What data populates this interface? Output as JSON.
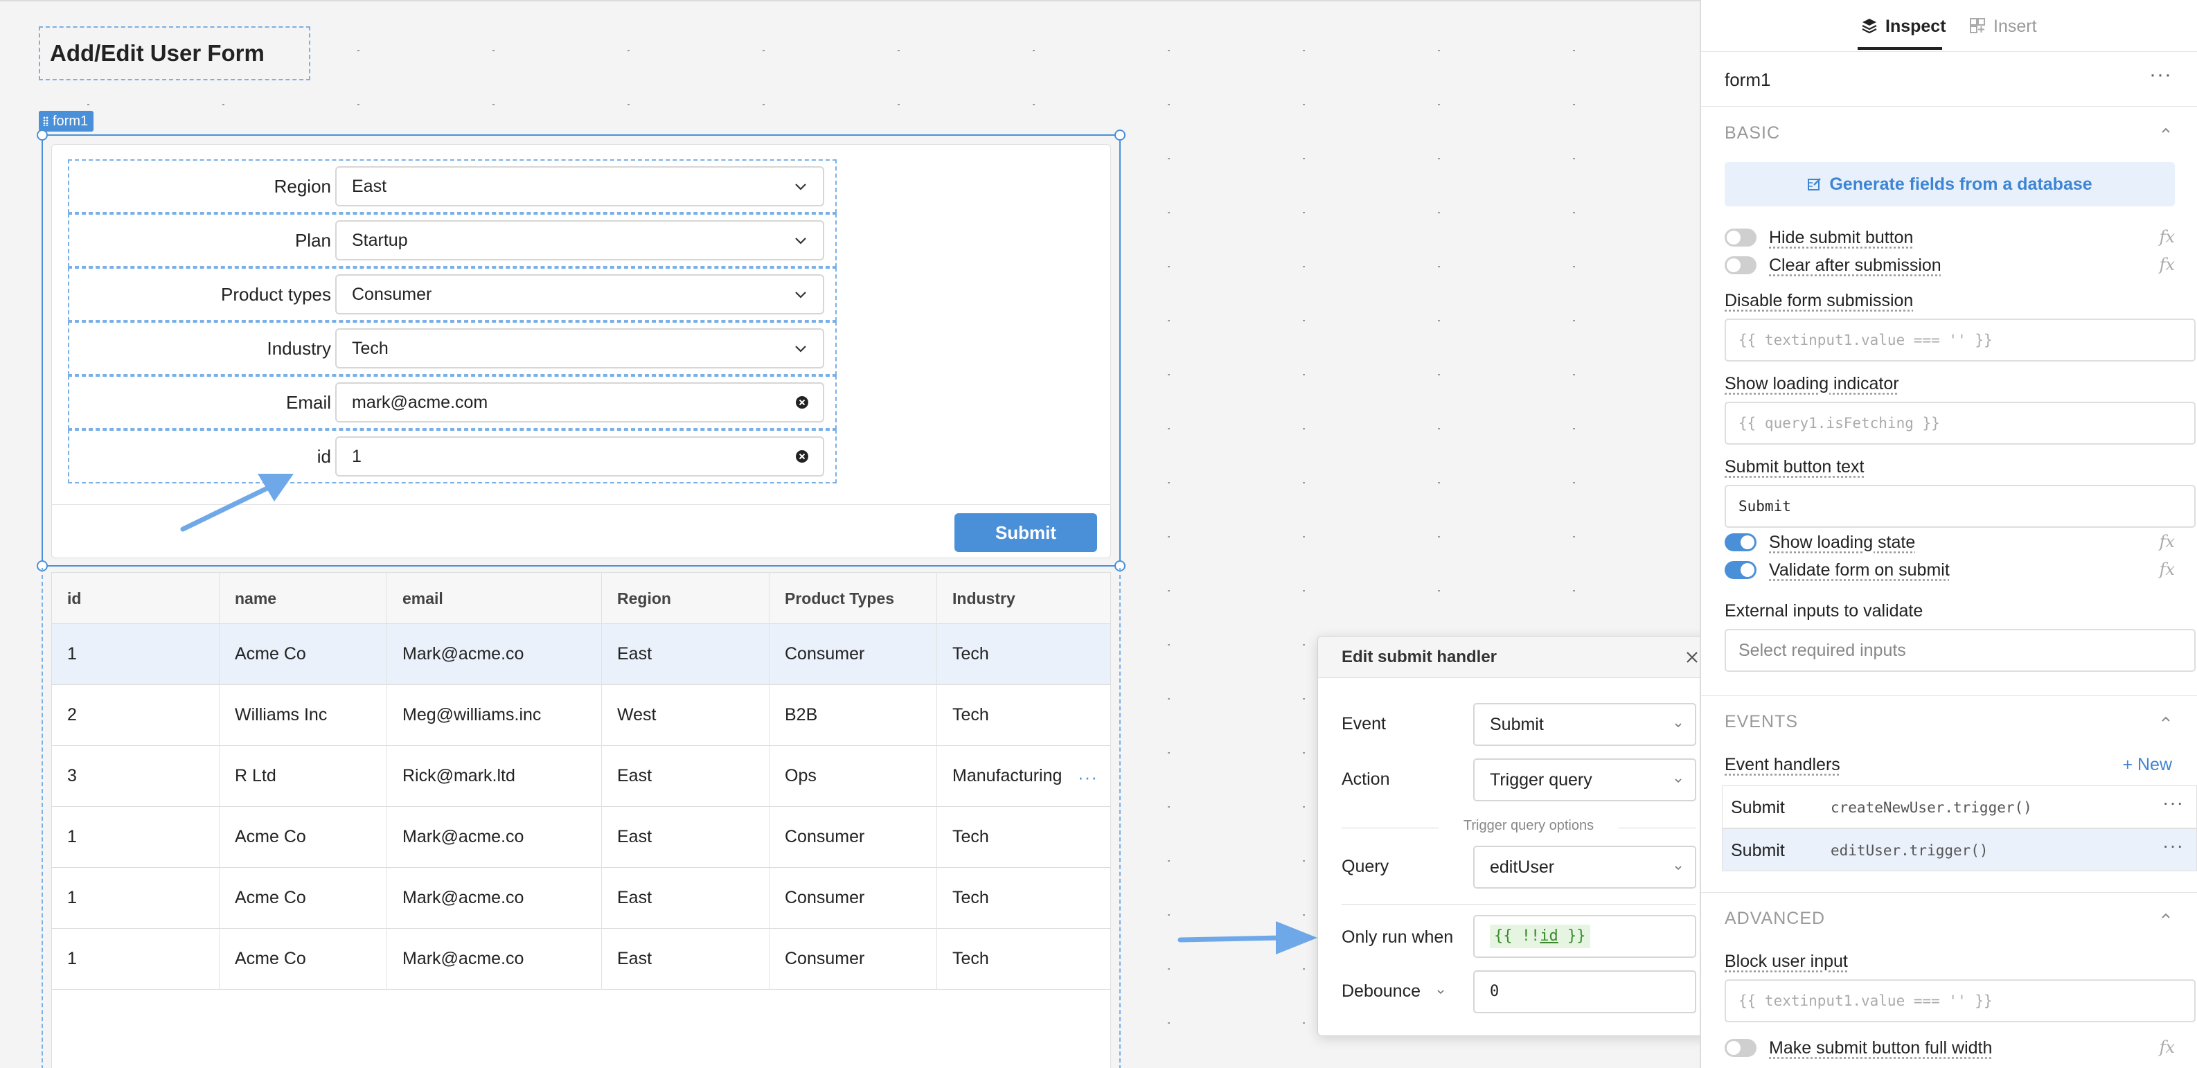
{
  "app": {
    "page_title": "Add/Edit User Form",
    "form_tag": "form1"
  },
  "form": {
    "fields": [
      {
        "label": "Region",
        "value": "East",
        "type": "select"
      },
      {
        "label": "Plan",
        "value": "Startup",
        "type": "select"
      },
      {
        "label": "Product types",
        "value": "Consumer",
        "type": "select"
      },
      {
        "label": "Industry",
        "value": "Tech",
        "type": "select"
      },
      {
        "label": "Email",
        "value": "mark@acme.com",
        "type": "text"
      },
      {
        "label": "id",
        "value": "1",
        "type": "text"
      }
    ],
    "submit_label": "Submit"
  },
  "table": {
    "columns": [
      "id",
      "name",
      "email",
      "Region",
      "Product Types",
      "Industry"
    ],
    "rows": [
      [
        "1",
        "Acme Co",
        "Mark@acme.co",
        "East",
        "Consumer",
        "Tech"
      ],
      [
        "2",
        "Williams Inc",
        "Meg@williams.inc",
        "West",
        "B2B",
        "Tech"
      ],
      [
        "3",
        "R Ltd",
        "Rick@mark.ltd",
        "East",
        "Ops",
        "Manufacturing"
      ],
      [
        "1",
        "Acme Co",
        "Mark@acme.co",
        "East",
        "Consumer",
        "Tech"
      ],
      [
        "1",
        "Acme Co",
        "Mark@acme.co",
        "East",
        "Consumer",
        "Tech"
      ],
      [
        "1",
        "Acme Co",
        "Mark@acme.co",
        "East",
        "Consumer",
        "Tech"
      ]
    ],
    "row_more": "···"
  },
  "popover": {
    "title": "Edit submit handler",
    "event_label": "Event",
    "event_value": "Submit",
    "action_label": "Action",
    "action_value": "Trigger query",
    "section_label": "Trigger query options",
    "query_label": "Query",
    "query_value": "editUser",
    "only_run_label": "Only run when",
    "only_run_open": "{{ ",
    "only_run_bang": "!!",
    "only_run_var": "id",
    "only_run_close": " }}",
    "debounce_label": "Debounce",
    "debounce_value": "0"
  },
  "inspector": {
    "tabs": {
      "inspect": "Inspect",
      "insert": "Insert"
    },
    "component_name": "form1",
    "more": "···",
    "basic": {
      "title": "BASIC",
      "generate_button": "Generate fields from a database",
      "hide_submit": "Hide submit button",
      "clear_after": "Clear after submission",
      "disable_label": "Disable form submission",
      "disable_placeholder": "{{ textinput1.value === '' }}",
      "loading_label": "Show loading indicator",
      "loading_placeholder": "{{ query1.isFetching }}",
      "submit_text_label": "Submit button text",
      "submit_text_value": "Submit",
      "show_loading_state": "Show loading state",
      "validate_on_submit": "Validate form on submit",
      "external_label": "External inputs to validate",
      "external_placeholder": "Select required inputs",
      "fx": "fx"
    },
    "events": {
      "title": "EVENTS",
      "handlers_label": "Event handlers",
      "new_label": "+ New",
      "handlers": [
        {
          "event": "Submit",
          "code": "createNewUser.trigger()"
        },
        {
          "event": "Submit",
          "code": "editUser.trigger()"
        }
      ]
    },
    "advanced": {
      "title": "ADVANCED",
      "block_label": "Block user input",
      "block_placeholder": "{{ textinput1.value === '' }}",
      "full_width": "Make submit button full width"
    }
  },
  "colors": {
    "accent": "#4a90d9",
    "annotation_arrow": "#6fa8e8",
    "selected_row": "#eaf1fb"
  }
}
